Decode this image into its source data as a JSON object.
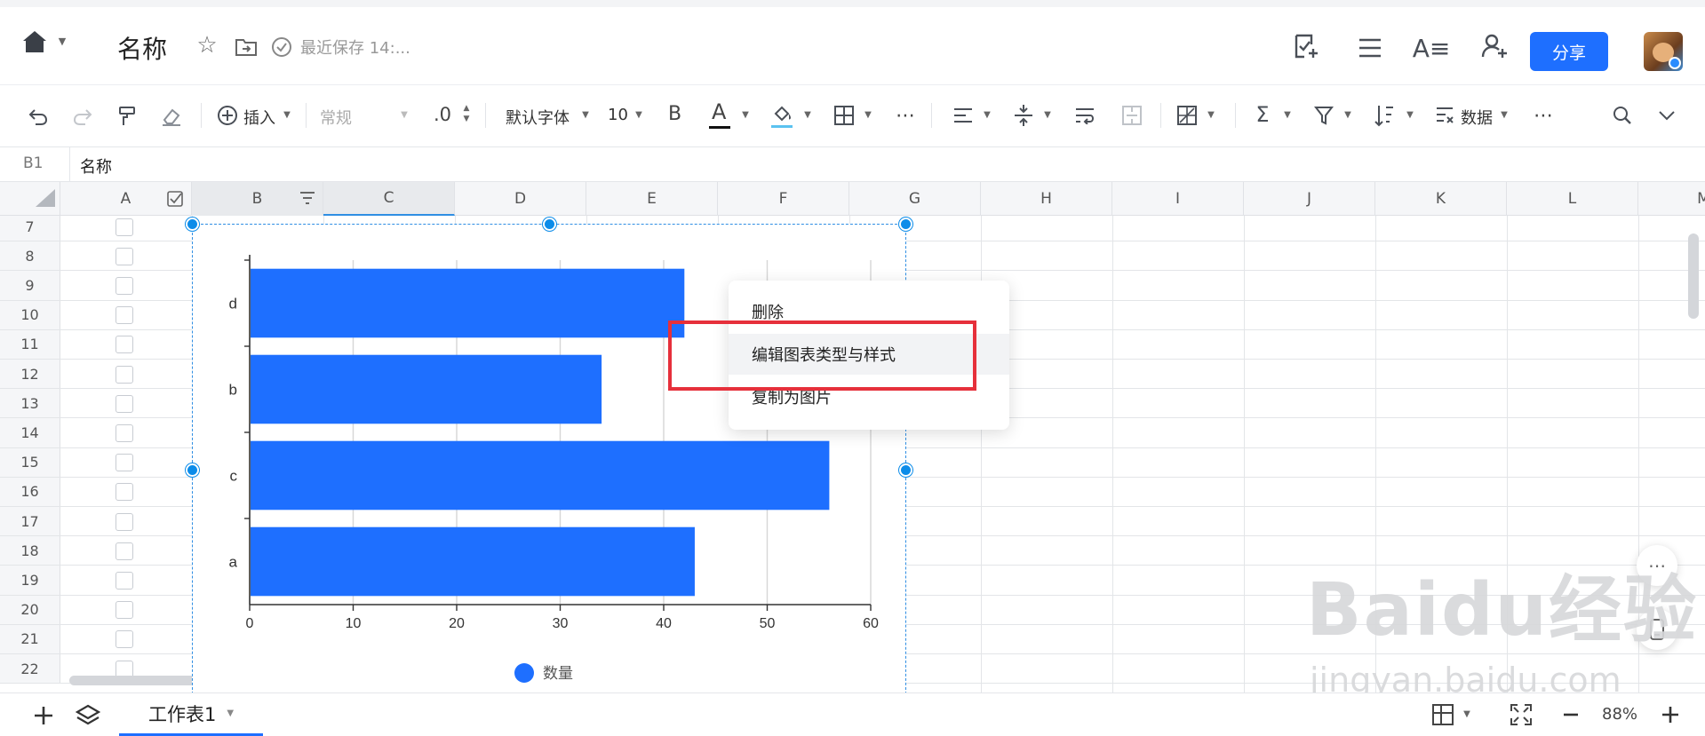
{
  "header": {
    "doc_title": "名称",
    "save_status": "最近保存 14:...",
    "share_label": "分享"
  },
  "toolbar": {
    "insert_label": "插入",
    "number_format": "常规",
    "decimal": ".0",
    "font_name": "默认字体",
    "font_size": "10",
    "bold": "B",
    "font_color_letter": "A",
    "data_label": "数据"
  },
  "formula_bar": {
    "cell_ref": "B1",
    "cell_value": "名称"
  },
  "columns": [
    "A",
    "B",
    "C",
    "D",
    "E",
    "F",
    "G",
    "H",
    "I",
    "J",
    "K",
    "L",
    "M"
  ],
  "rows": [
    "7",
    "8",
    "9",
    "10",
    "11",
    "12",
    "13",
    "14",
    "15",
    "16",
    "17",
    "18",
    "19",
    "20",
    "21",
    "22"
  ],
  "chart_data": {
    "type": "bar",
    "orientation": "horizontal",
    "categories": [
      "d",
      "b",
      "c",
      "a"
    ],
    "series": [
      {
        "name": "数量",
        "values": [
          42,
          34,
          56,
          43
        ],
        "color": "#1e6fff"
      }
    ],
    "x_ticks": [
      "0",
      "10",
      "20",
      "30",
      "40",
      "50",
      "60"
    ],
    "xlim": [
      0,
      60
    ],
    "grid": "vertical",
    "legend": "bottom"
  },
  "context_menu": {
    "items": [
      "删除",
      "编辑图表类型与样式",
      "复制为图片"
    ],
    "highlight_color": "#e6303b"
  },
  "sheet_tabs": [
    {
      "label": "工作表1",
      "active": true
    }
  ],
  "zoom": "88%",
  "watermark": {
    "text": "Baidu经验",
    "sub": "jingyan.baidu.com"
  },
  "colors": {
    "accent": "#1e6fff",
    "selection": "#0c8ce9"
  }
}
